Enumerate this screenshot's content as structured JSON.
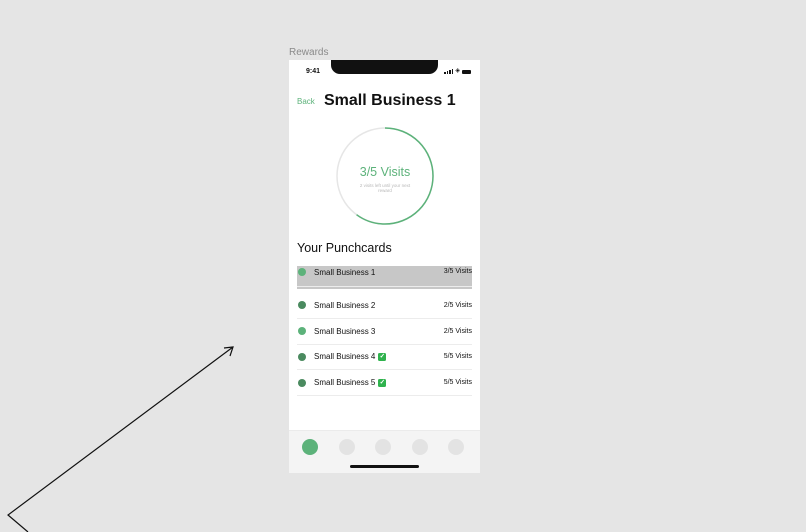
{
  "frame_label": "Rewards",
  "status_bar": {
    "time": "9:41"
  },
  "header": {
    "back_label": "Back",
    "title": "Small Business 1"
  },
  "progress": {
    "label": "3/5 Visits",
    "sub_label": "2 visits left until your next reward",
    "fraction": 0.6
  },
  "punchcards": {
    "heading": "Your Punchcards",
    "items": [
      {
        "name": "Small Business 1",
        "visits": "3/5 Visits",
        "completed": false
      },
      {
        "name": "Small Business 2",
        "visits": "2/5 Visits",
        "completed": false
      },
      {
        "name": "Small Business 3",
        "visits": "2/5 Visits",
        "completed": false
      },
      {
        "name": "Small Business 4",
        "visits": "5/5 Visits",
        "completed": true
      },
      {
        "name": "Small Business 5",
        "visits": "5/5 Visits",
        "completed": true
      }
    ]
  },
  "tab_bar": {
    "active_index": 0,
    "count": 5
  },
  "colors": {
    "accent": "#5cb27a",
    "accent_dark": "#4a8a5f",
    "check": "#2fb24d",
    "canvas": "#e5e5e5"
  }
}
